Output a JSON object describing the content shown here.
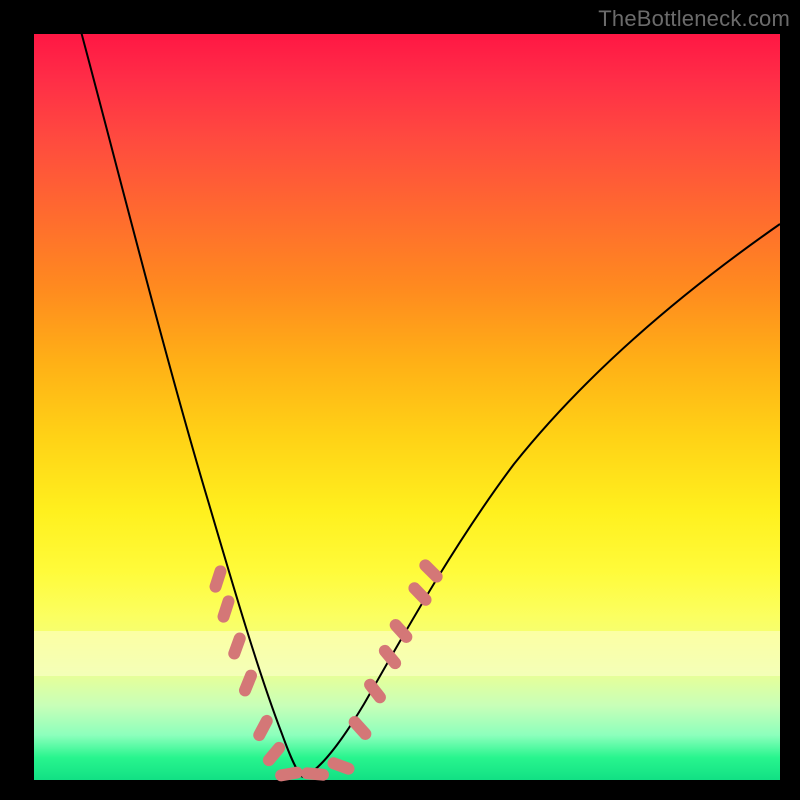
{
  "attribution": "TheBottleneck.com",
  "colors": {
    "background": "#000000",
    "gradient_top": "#ff1744",
    "gradient_mid": "#ffd216",
    "gradient_bottom": "#12e084",
    "curve": "#000000",
    "marker": "#d47777"
  },
  "chart_data": {
    "type": "line",
    "title": "",
    "xlabel": "",
    "ylabel": "",
    "xlim": [
      0,
      100
    ],
    "ylim": [
      0,
      100
    ],
    "series": [
      {
        "name": "left-branch",
        "x": [
          6,
          8,
          10,
          12,
          14,
          16,
          18,
          20,
          22,
          24,
          26,
          28,
          30,
          31,
          32,
          33,
          34,
          35
        ],
        "y": [
          100,
          92,
          84,
          76,
          68,
          60,
          52,
          44,
          36,
          28,
          21,
          14,
          8,
          5,
          3,
          1.5,
          0.5,
          0
        ]
      },
      {
        "name": "right-branch",
        "x": [
          35,
          36,
          38,
          40,
          42,
          44,
          46,
          48,
          52,
          56,
          60,
          64,
          70,
          76,
          82,
          88,
          94,
          100
        ],
        "y": [
          0,
          0.5,
          2,
          4,
          7,
          10,
          13,
          16,
          22,
          28,
          33,
          38,
          45,
          52,
          58,
          64,
          70,
          75
        ]
      }
    ],
    "markers": [
      {
        "series": "left-branch",
        "x": 24.5,
        "y": 27,
        "shape": "pill",
        "angle": -72
      },
      {
        "series": "left-branch",
        "x": 25.5,
        "y": 23,
        "shape": "pill",
        "angle": -72
      },
      {
        "series": "left-branch",
        "x": 27.0,
        "y": 18,
        "shape": "pill",
        "angle": -70
      },
      {
        "series": "left-branch",
        "x": 28.5,
        "y": 13,
        "shape": "pill",
        "angle": -68
      },
      {
        "series": "left-branch",
        "x": 30.5,
        "y": 7,
        "shape": "pill",
        "angle": -62
      },
      {
        "series": "left-branch",
        "x": 32.0,
        "y": 3.5,
        "shape": "pill",
        "angle": -50
      },
      {
        "series": "floor",
        "x": 34.0,
        "y": 0.5,
        "shape": "pill",
        "angle": -10
      },
      {
        "series": "floor",
        "x": 37.5,
        "y": 0.5,
        "shape": "pill",
        "angle": 5
      },
      {
        "series": "floor",
        "x": 41.0,
        "y": 2.0,
        "shape": "pill",
        "angle": 20
      },
      {
        "series": "right-branch",
        "x": 43.5,
        "y": 7,
        "shape": "pill",
        "angle": 48
      },
      {
        "series": "right-branch",
        "x": 45.5,
        "y": 12,
        "shape": "pill",
        "angle": 52
      },
      {
        "series": "right-branch",
        "x": 47.5,
        "y": 16.5,
        "shape": "pill",
        "angle": 50
      },
      {
        "series": "right-branch",
        "x": 49.0,
        "y": 20,
        "shape": "pill",
        "angle": 48
      },
      {
        "series": "right-branch",
        "x": 51.5,
        "y": 25,
        "shape": "pill",
        "angle": 46
      },
      {
        "series": "right-branch",
        "x": 53.0,
        "y": 28,
        "shape": "pill",
        "angle": 45
      }
    ],
    "bands": [
      {
        "name": "pale-yellow-band",
        "y_from": 14,
        "y_to": 20
      }
    ]
  }
}
